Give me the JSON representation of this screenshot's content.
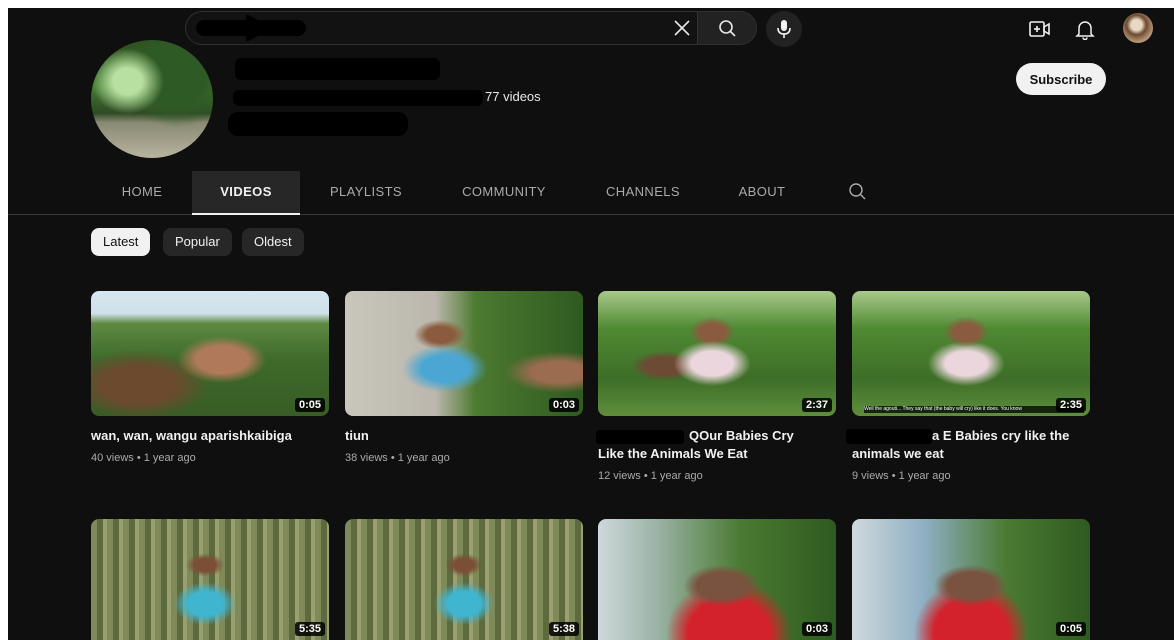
{
  "topbar": {
    "search_value": "",
    "icons": [
      "clear-icon",
      "search-icon",
      "mic-icon",
      "create-video-icon",
      "notifications-icon",
      "account-avatar"
    ]
  },
  "channel": {
    "video_count": "77 videos",
    "subscribe_label": "Subscribe"
  },
  "tabs": [
    {
      "label": "HOME",
      "active": false
    },
    {
      "label": "VIDEOS",
      "active": true
    },
    {
      "label": "PLAYLISTS",
      "active": false
    },
    {
      "label": "COMMUNITY",
      "active": false
    },
    {
      "label": "CHANNELS",
      "active": false
    },
    {
      "label": "ABOUT",
      "active": false
    }
  ],
  "chips": [
    {
      "label": "Latest",
      "active": true
    },
    {
      "label": "Popular",
      "active": false
    },
    {
      "label": "Oldest",
      "active": false
    }
  ],
  "videos": [
    {
      "duration": "0:05",
      "title": "wan, wan, wangu aparishkaibiga",
      "meta": "40 views • 1 year ago"
    },
    {
      "duration": "0:03",
      "title": "tiun",
      "meta": "38 views • 1 year ago"
    },
    {
      "duration": "2:37",
      "title": "QOur Babies Cry Like the Animals We Eat",
      "title_line1": "QOur Babies Cry",
      "title_line2": "Like the Animals We Eat",
      "meta": "12 views • 1 year ago"
    },
    {
      "duration": "2:35",
      "title": "a E Babies cry like the animals we eat",
      "title_line1": "a E Babies cry like the",
      "title_line2": "animals we eat",
      "meta": "9 views • 1 year ago",
      "caption": "Well the agouti... They say that (the baby will cry) like it does. You know"
    },
    {
      "duration": "5:35"
    },
    {
      "duration": "5:38"
    },
    {
      "duration": "0:03"
    },
    {
      "duration": "0:05"
    }
  ],
  "colors": {
    "background": "#0f0f0f",
    "chip_active": "#f1f1f1",
    "chip": "#272727",
    "text": "#f1f1f1",
    "meta_text": "#aaaaaa"
  }
}
